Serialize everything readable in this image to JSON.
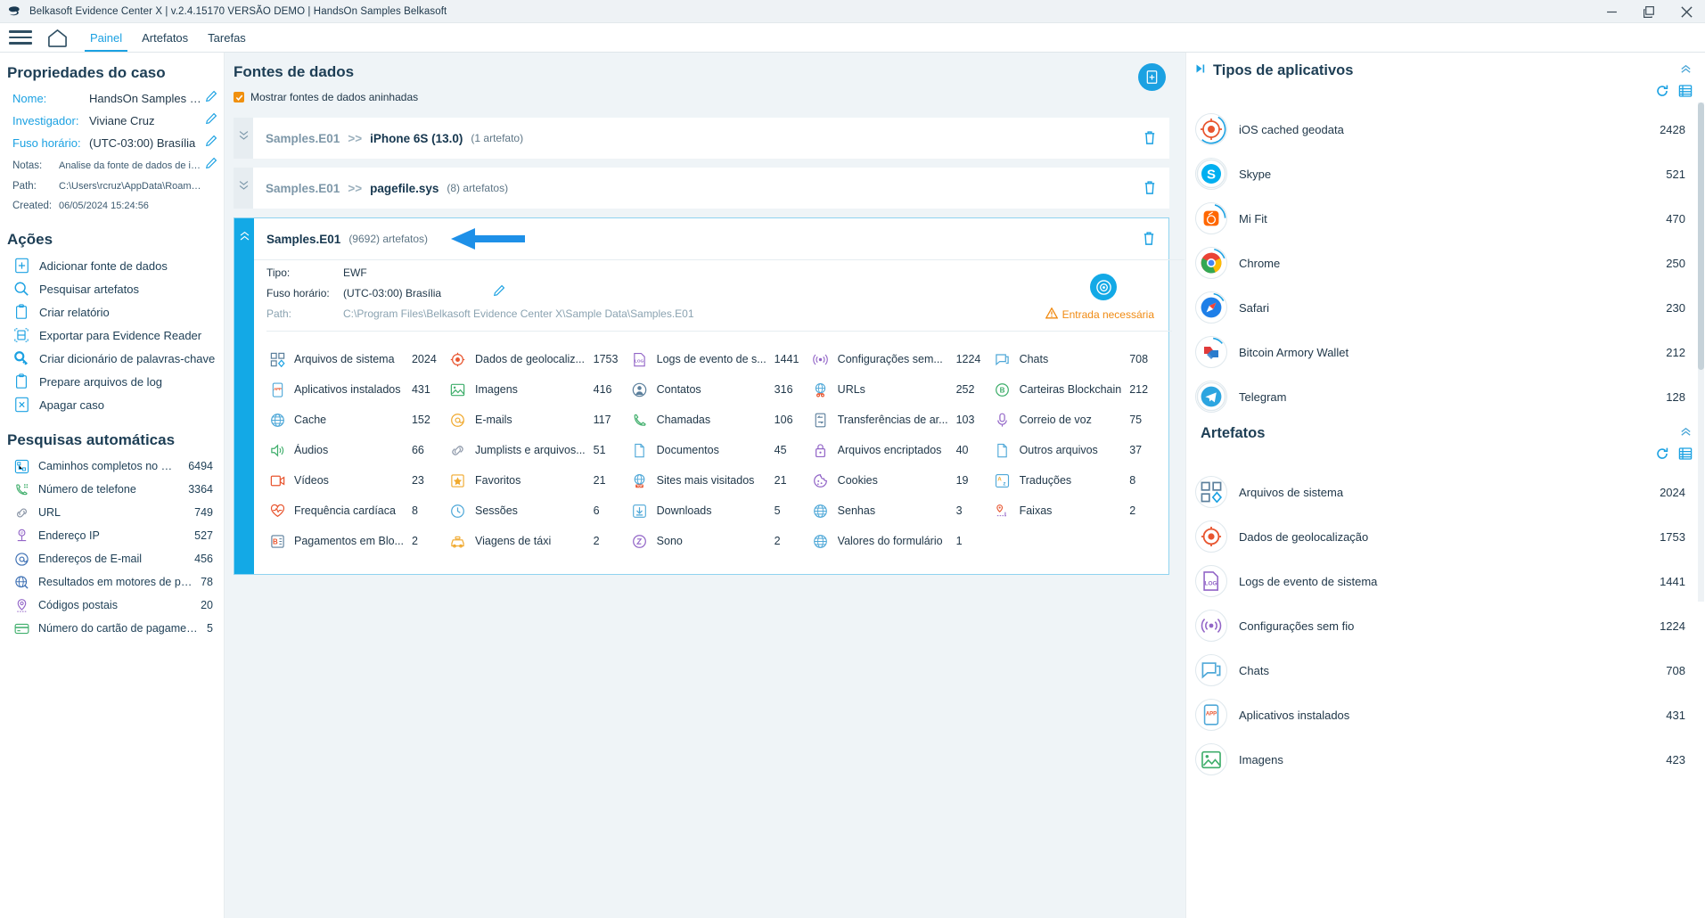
{
  "window": {
    "title": "Belkasoft Evidence Center X | v.2.4.15170 VERSÃO DEMO | HandsOn Samples Belkasoft",
    "minimize": "—",
    "restore": "❐",
    "close": "✕"
  },
  "nav": {
    "menu_icon": "hamburger-icon",
    "home_icon": "home-icon",
    "tabs": [
      {
        "label": "Painel",
        "active": true
      },
      {
        "label": "Artefatos",
        "active": false
      },
      {
        "label": "Tarefas",
        "active": false
      }
    ]
  },
  "case_properties": {
    "heading": "Propriedades do caso",
    "rows": [
      {
        "label": "Nome:",
        "value": "HandsOn Samples Belka",
        "editable": true,
        "accent": true
      },
      {
        "label": "Investigador:",
        "value": "Viviane Cruz",
        "editable": true,
        "accent": true
      },
      {
        "label": "Fuso horário:",
        "value": "(UTC-03:00) Brasília",
        "editable": true,
        "accent": true
      },
      {
        "label": "Notas:",
        "value": "Analise da fonte de dados de image",
        "editable": true,
        "accent": false
      },
      {
        "label": "Path:",
        "value": "C:\\Users\\rcruz\\AppData\\Roaming\\...",
        "editable": false,
        "accent": false
      },
      {
        "label": "Created:",
        "value": "06/05/2024 15:24:56",
        "editable": false,
        "accent": false
      }
    ]
  },
  "actions": {
    "heading": "Ações",
    "items": [
      {
        "label": "Adicionar fonte de dados",
        "icon": "file-plus-icon"
      },
      {
        "label": "Pesquisar artefatos",
        "icon": "magnifier-icon"
      },
      {
        "label": "Criar relatório",
        "icon": "clipboard-icon"
      },
      {
        "label": "Exportar para Evidence Reader",
        "icon": "export-icon"
      },
      {
        "label": "Criar dicionário de palavras-chave",
        "icon": "key-search-icon"
      },
      {
        "label": "Prepare arquivos de log",
        "icon": "clipboard-icon"
      },
      {
        "label": "Apagar caso",
        "icon": "file-x-icon"
      }
    ]
  },
  "auto_searches": {
    "heading": "Pesquisas automáticas",
    "items": [
      {
        "label": "Caminhos completos no Wi...",
        "count": "6494",
        "icon": "path-icon"
      },
      {
        "label": "Número de telefone",
        "count": "3364",
        "icon": "phone-icon"
      },
      {
        "label": "URL",
        "count": "749",
        "icon": "link-icon"
      },
      {
        "label": "Endereço IP",
        "count": "527",
        "icon": "ip-icon"
      },
      {
        "label": "Endereços de E-mail",
        "count": "456",
        "icon": "at-icon"
      },
      {
        "label": "Resultados em motores de pes...",
        "count": "78",
        "icon": "globe-search-icon"
      },
      {
        "label": "Códigos postais",
        "count": "20",
        "icon": "pin-icon"
      },
      {
        "label": "Número do cartão de pagamento",
        "count": "5",
        "icon": "card-icon"
      }
    ]
  },
  "data_sources": {
    "heading": "Fontes de dados",
    "checkbox_label": "Mostrar fontes de dados aninhadas",
    "checkbox_checked": true,
    "add_button_icon": "add-data-source-icon",
    "cards": [
      {
        "parent": "Samples.E01",
        "separator": ">>",
        "name": "iPhone 6S (13.0)",
        "count": "(1 artefato)",
        "expanded": false,
        "has_arrow": false
      },
      {
        "parent": "Samples.E01",
        "separator": ">>",
        "name": "pagefile.sys",
        "count": "(8) artefatos)",
        "expanded": false,
        "has_arrow": false
      },
      {
        "parent": "",
        "separator": "",
        "name": "Samples.E01",
        "count": "(9692) artefatos)",
        "expanded": true,
        "has_arrow": true
      }
    ],
    "detail": {
      "rows": [
        {
          "label": "Tipo:",
          "value": "EWF",
          "dim": false,
          "editable": false
        },
        {
          "label": "Fuso horário:",
          "value": "(UTC-03:00) Brasília",
          "dim": false,
          "editable": true
        },
        {
          "label": "Path:",
          "value": "C:\\Program Files\\Belkasoft Evidence Center X\\Sample Data\\Samples.E01",
          "dim": true,
          "editable": false
        }
      ],
      "analyze_icon": "analyze-icon",
      "warning_icon": "warning-icon",
      "warning_text": "Entrada necessária"
    },
    "artifacts": [
      {
        "label": "Arquivos de sistema",
        "count": "2024",
        "icon": "system-files-icon"
      },
      {
        "label": "Dados de geolocaliz...",
        "count": "1753",
        "icon": "geolocation-icon"
      },
      {
        "label": "Logs de evento de s...",
        "count": "1441",
        "icon": "event-log-icon"
      },
      {
        "label": "Configurações sem...",
        "count": "1224",
        "icon": "wireless-icon"
      },
      {
        "label": "Chats",
        "count": "708",
        "icon": "chat-icon"
      },
      {
        "label": "Aplicativos instalados",
        "count": "431",
        "icon": "app-icon"
      },
      {
        "label": "Imagens",
        "count": "416",
        "icon": "image-icon"
      },
      {
        "label": "Contatos",
        "count": "316",
        "icon": "contact-icon"
      },
      {
        "label": "URLs",
        "count": "252",
        "icon": "url-icon"
      },
      {
        "label": "Carteiras Blockchain",
        "count": "212",
        "icon": "blockchain-icon"
      },
      {
        "label": "Cache",
        "count": "152",
        "icon": "cache-icon"
      },
      {
        "label": "E-mails",
        "count": "117",
        "icon": "email-icon"
      },
      {
        "label": "Chamadas",
        "count": "106",
        "icon": "call-icon"
      },
      {
        "label": "Transferências de ar...",
        "count": "103",
        "icon": "transfer-icon"
      },
      {
        "label": "Correio de voz",
        "count": "75",
        "icon": "voicemail-icon"
      },
      {
        "label": "Áudios",
        "count": "66",
        "icon": "audio-icon"
      },
      {
        "label": "Jumplists e arquivos...",
        "count": "51",
        "icon": "jumplist-icon"
      },
      {
        "label": "Documentos",
        "count": "45",
        "icon": "document-icon"
      },
      {
        "label": "Arquivos encriptados",
        "count": "40",
        "icon": "encrypted-icon"
      },
      {
        "label": "Outros arquivos",
        "count": "37",
        "icon": "other-files-icon"
      },
      {
        "label": "Vídeos",
        "count": "23",
        "icon": "video-icon"
      },
      {
        "label": "Favoritos",
        "count": "21",
        "icon": "bookmark-icon"
      },
      {
        "label": "Sites mais visitados",
        "count": "21",
        "icon": "top-sites-icon"
      },
      {
        "label": "Cookies",
        "count": "19",
        "icon": "cookie-icon"
      },
      {
        "label": "Traduções",
        "count": "8",
        "icon": "translation-icon"
      },
      {
        "label": "Frequência cardíaca",
        "count": "8",
        "icon": "heart-rate-icon"
      },
      {
        "label": "Sessões",
        "count": "6",
        "icon": "session-icon"
      },
      {
        "label": "Downloads",
        "count": "5",
        "icon": "download-icon"
      },
      {
        "label": "Senhas",
        "count": "3",
        "icon": "password-icon"
      },
      {
        "label": "Faixas",
        "count": "2",
        "icon": "tracks-icon"
      },
      {
        "label": "Pagamentos em Blo...",
        "count": "2",
        "icon": "blockchain-payment-icon"
      },
      {
        "label": "Viagens de táxi",
        "count": "2",
        "icon": "taxi-icon"
      },
      {
        "label": "Sono",
        "count": "2",
        "icon": "sleep-icon"
      },
      {
        "label": "Valores do formulário",
        "count": "1",
        "icon": "form-values-icon"
      }
    ]
  },
  "app_types": {
    "heading": "Tipos de aplicativos",
    "collapse_icon": "chevron-up-icon",
    "expand_icon": "play-icon",
    "refresh_icon": "refresh-icon",
    "list_icon": "list-icon",
    "items": [
      {
        "label": "iOS cached geodata",
        "count": "2428",
        "icon": "geolocation-icon"
      },
      {
        "label": "Skype",
        "count": "521",
        "icon": "skype-icon"
      },
      {
        "label": "Mi Fit",
        "count": "470",
        "icon": "mifit-icon"
      },
      {
        "label": "Chrome",
        "count": "250",
        "icon": "chrome-icon"
      },
      {
        "label": "Safari",
        "count": "230",
        "icon": "safari-icon"
      },
      {
        "label": "Bitcoin Armory Wallet",
        "count": "212",
        "icon": "bitcoin-armory-icon"
      },
      {
        "label": "Telegram",
        "count": "128",
        "icon": "telegram-icon"
      }
    ]
  },
  "artifacts_panel": {
    "heading": "Artefatos",
    "collapse_icon": "chevron-up-icon",
    "refresh_icon": "refresh-icon",
    "list_icon": "list-icon",
    "items": [
      {
        "label": "Arquivos de sistema",
        "count": "2024",
        "icon": "system-files-icon"
      },
      {
        "label": "Dados de geolocalização",
        "count": "1753",
        "icon": "geolocation-icon"
      },
      {
        "label": "Logs de evento de sistema",
        "count": "1441",
        "icon": "event-log-icon"
      },
      {
        "label": "Configurações sem fio",
        "count": "1224",
        "icon": "wireless-icon"
      },
      {
        "label": "Chats",
        "count": "708",
        "icon": "chat-icon"
      },
      {
        "label": "Aplicativos instalados",
        "count": "431",
        "icon": "app-icon"
      },
      {
        "label": "Imagens",
        "count": "423",
        "icon": "image-icon"
      }
    ]
  },
  "colors": {
    "accent": "#1ba1e2",
    "warning": "#f08a12",
    "text": "#21384a",
    "muted": "#8ba3b1",
    "panel_bg": "#eff4f7"
  }
}
